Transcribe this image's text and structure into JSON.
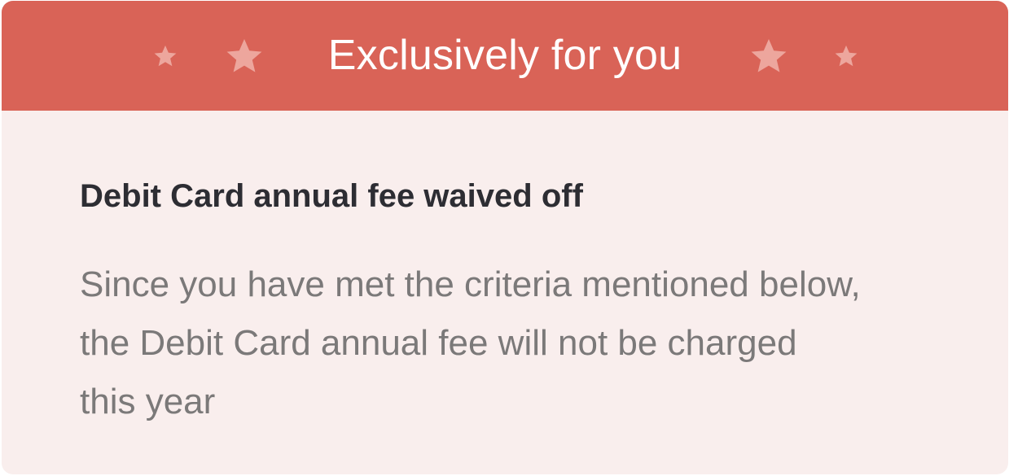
{
  "banner": {
    "title": "Exclusively for you",
    "color": "#d96357",
    "star_color": "#eda69d",
    "icons": [
      "star-icon",
      "star-icon",
      "star-icon",
      "star-icon"
    ]
  },
  "offer": {
    "title": "Debit Card annual fee waived off",
    "description": "Since you have met the criteria mentioned below, the Debit Card annual fee will not be charged this year",
    "background": "#f9eeed"
  }
}
